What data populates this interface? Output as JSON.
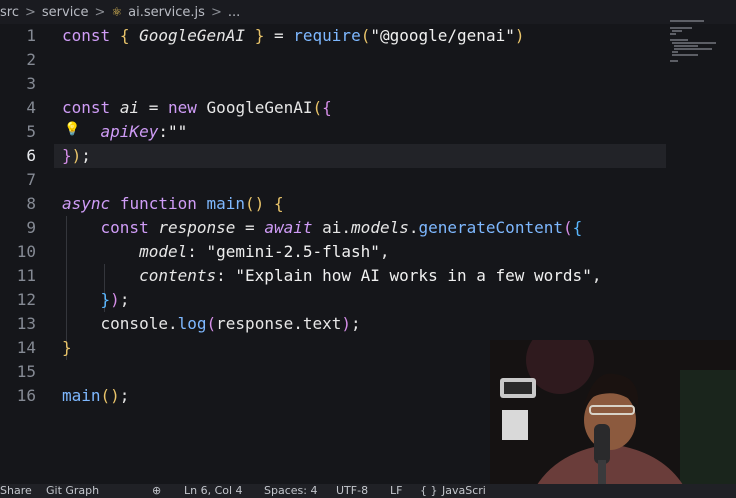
{
  "breadcrumb": {
    "items": [
      "src",
      "service",
      "ai.service.js",
      "..."
    ],
    "separator": ">"
  },
  "editor": {
    "active_line": 6,
    "line_numbers": [
      "1",
      "2",
      "3",
      "4",
      "5",
      "6",
      "7",
      "8",
      "9",
      "10",
      "11",
      "12",
      "13",
      "14",
      "15",
      "16"
    ],
    "tokens": {
      "l1": [
        "const",
        "{",
        "GoogleGenAI",
        "}",
        "=",
        "require",
        "(",
        "\"@google/genai\"",
        ")"
      ],
      "l4": [
        "const",
        "ai",
        "=",
        "new",
        "GoogleGenAI",
        "(",
        "{"
      ],
      "l5": [
        "apiKey",
        ":",
        "\"\""
      ],
      "l6": [
        "}",
        ")",
        ";"
      ],
      "l8": [
        "async",
        "function",
        "main",
        "()",
        "{"
      ],
      "l9": [
        "const",
        "response",
        "=",
        "await",
        "ai",
        ".",
        "models",
        ".",
        "generateContent",
        "(",
        "{"
      ],
      "l10": [
        "model",
        ":",
        "\"gemini-2.5-flash\"",
        ","
      ],
      "l11": [
        "contents",
        ":",
        "\"Explain how AI works in a few words\"",
        ","
      ],
      "l12": [
        "}",
        ")",
        ";"
      ],
      "l13": [
        "console",
        ".",
        "log",
        "(",
        "response",
        ".",
        "text",
        ")",
        ";"
      ],
      "l14": [
        "}"
      ],
      "l16": [
        "main",
        "()",
        ";"
      ]
    }
  },
  "statusbar": {
    "share": "Share",
    "git_graph": "Git Graph",
    "position": "Ln 6, Col 4",
    "spaces": "Spaces: 4",
    "encoding": "UTF-8",
    "eol": "LF",
    "brackets": "{ }",
    "language": "JavaScri"
  },
  "colors": {
    "keyword": "#cf9cf6",
    "function": "#7eb8ff",
    "bracket_gold": "#e9c46a",
    "bracket_purple": "#d58ee8",
    "bracket_blue": "#59b7ff",
    "background": "#15161a"
  },
  "icons": {
    "breadcrumb_file": "react-icon",
    "lightbulb": "lightbulb-icon",
    "status_remote": "remote-icon"
  }
}
